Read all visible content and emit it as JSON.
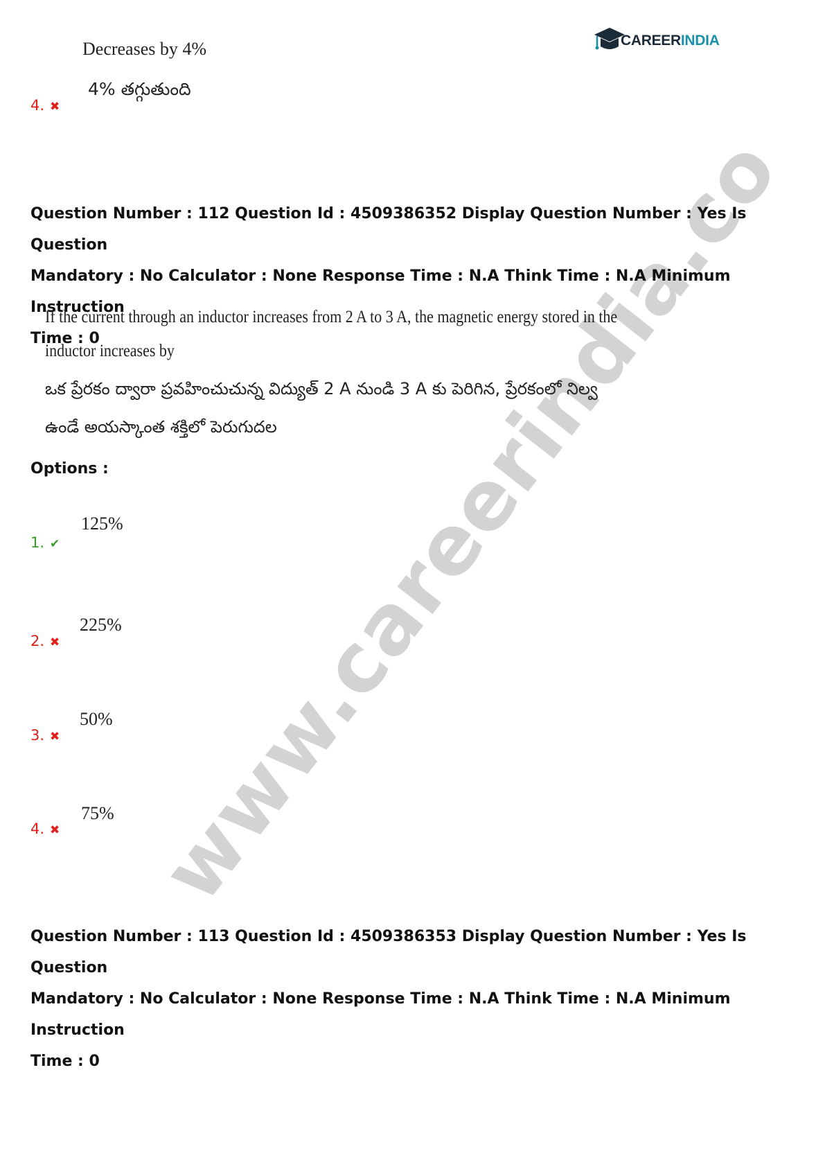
{
  "logo": {
    "part1": "CAREER",
    "part2": "INDIA"
  },
  "prev_question": {
    "option4": {
      "number": "4.",
      "status": "wrong",
      "text_en": "Decreases by 4%",
      "text_te": "4% తగ్గుతుంది"
    }
  },
  "question_112": {
    "meta_line1": "Question Number : 112 Question Id : 4509386352 Display Question Number : Yes Is Question",
    "meta_line2": "Mandatory : No Calculator : None Response Time : N.A Think Time : N.A Minimum Instruction",
    "meta_line3": "Time : 0",
    "text_en_line1": "If the current through an inductor increases from 2 A to 3 A, the magnetic energy stored in the",
    "text_en_line2": "inductor increases by",
    "text_te_line1": "ఒక ప్రేరకం ద్వారా ప్రవహించుచున్న విద్యుత్ 2 A నుండి 3 A కు పెరిగిన, ప్రేరకంలో నిల్వ",
    "text_te_line2": "ఉండే అయస్కాంత శక్తిలో పెరుగుదల",
    "options_label": "Options :",
    "options": [
      {
        "number": "1.",
        "status": "correct",
        "text": "125%"
      },
      {
        "number": "2.",
        "status": "wrong",
        "text": "225%"
      },
      {
        "number": "3.",
        "status": "wrong",
        "text": "50%"
      },
      {
        "number": "4.",
        "status": "wrong",
        "text": "75%"
      }
    ]
  },
  "question_113": {
    "meta_line1": "Question Number : 113 Question Id : 4509386353 Display Question Number : Yes Is Question",
    "meta_line2": "Mandatory : No Calculator : None Response Time : N.A Think Time : N.A Minimum Instruction",
    "meta_line3": "Time : 0"
  },
  "watermark": "www.careerindia.co",
  "icons": {
    "wrong": "cross-icon",
    "correct": "check-icon"
  },
  "colors": {
    "wrong": "#e0201b",
    "correct": "#3a9a2a",
    "brand_dark": "#1c2b3a",
    "brand_accent": "#1a8fa8"
  }
}
